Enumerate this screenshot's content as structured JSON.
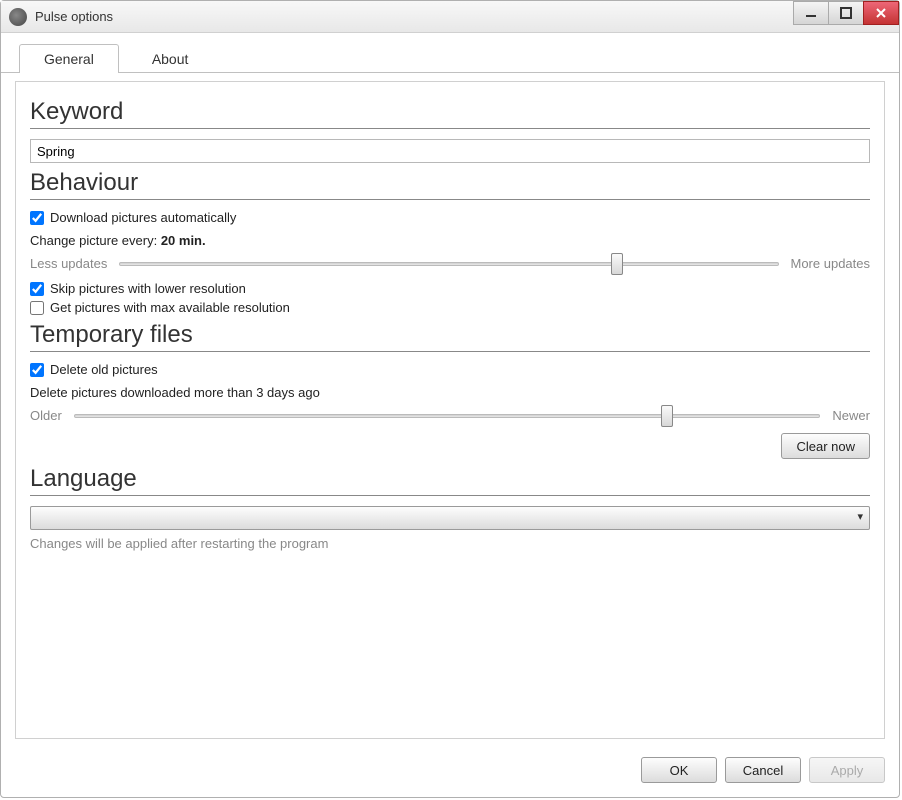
{
  "window": {
    "title": "Pulse options"
  },
  "tabs": {
    "general": "General",
    "about": "About"
  },
  "sections": {
    "keyword": {
      "title": "Keyword",
      "value": "Spring"
    },
    "behaviour": {
      "title": "Behaviour",
      "download_auto": "Download pictures automatically",
      "download_auto_checked": true,
      "change_every_label": "Change picture every:",
      "change_every_value": "20 min.",
      "slider_left": "Less updates",
      "slider_right": "More updates",
      "slider_value": 76,
      "skip_lower": "Skip pictures with lower resolution",
      "skip_lower_checked": true,
      "get_max": "Get pictures with max available resolution",
      "get_max_checked": false
    },
    "temp": {
      "title": "Temporary files",
      "delete_old": "Delete old pictures",
      "delete_old_checked": true,
      "delete_more_than": "Delete pictures downloaded more than 3 days ago",
      "slider_left": "Older",
      "slider_right": "Newer",
      "slider_value": 80,
      "clear_now": "Clear now"
    },
    "language": {
      "title": "Language",
      "selected": "",
      "hint": "Changes will be applied after restarting the program"
    }
  },
  "footer": {
    "ok": "OK",
    "cancel": "Cancel",
    "apply": "Apply"
  }
}
